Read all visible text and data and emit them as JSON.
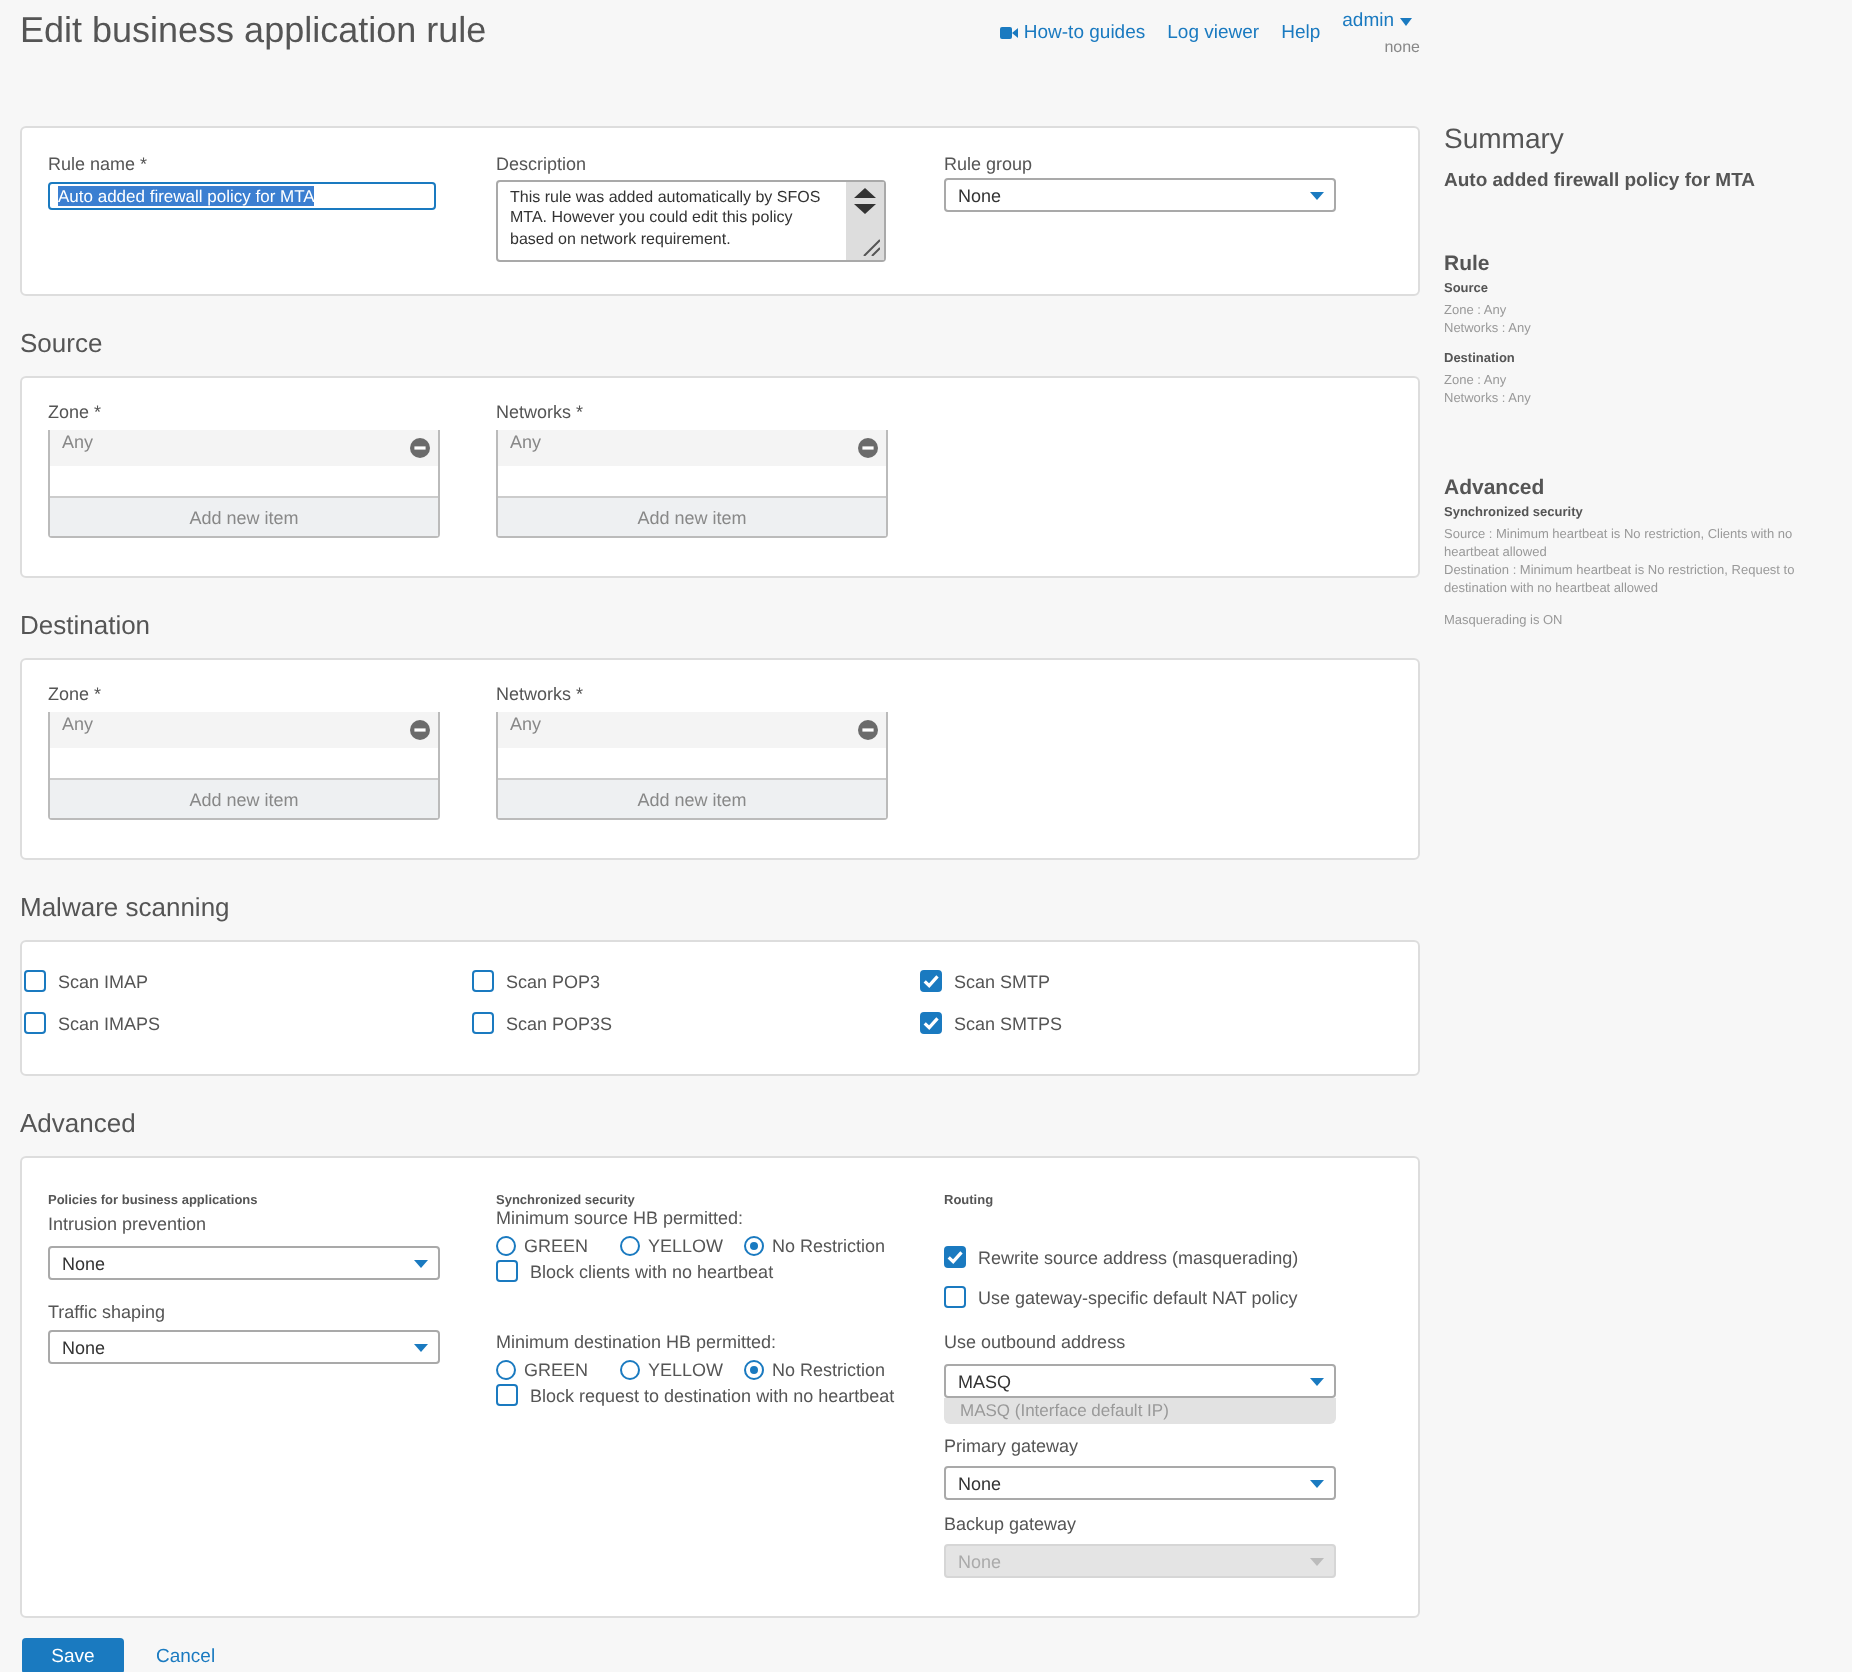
{
  "header": {
    "title": "Edit business application rule",
    "links": [
      {
        "label": "How-to guides",
        "kind": "video"
      },
      {
        "label": "Log viewer",
        "kind": "plain"
      },
      {
        "label": "Help",
        "kind": "plain"
      }
    ],
    "user": {
      "name": "admin",
      "subtitle": "none"
    }
  },
  "general": {
    "rule_name": {
      "label": "Rule name *",
      "value": "Auto added firewall policy for MTA",
      "text_selected": true
    },
    "description": {
      "label": "Description",
      "value": "This rule was added automatically by SFOS MTA. However you could edit this policy based on network requirement."
    },
    "rule_group": {
      "label": "Rule group",
      "value": "None",
      "disabled": false
    }
  },
  "source": {
    "title": "Source",
    "lists": [
      {
        "label": "Zone *",
        "items": [
          "Any"
        ],
        "add_label": "Add new item"
      },
      {
        "label": "Networks *",
        "items": [
          "Any"
        ],
        "add_label": "Add new item"
      }
    ]
  },
  "destination": {
    "title": "Destination",
    "lists": [
      {
        "label": "Zone *",
        "items": [
          "Any"
        ],
        "add_label": "Add new item"
      },
      {
        "label": "Networks *",
        "items": [
          "Any"
        ],
        "add_label": "Add new item"
      }
    ]
  },
  "malware_scanning": {
    "title": "Malware scanning",
    "options": [
      {
        "label": "Scan IMAP",
        "checked": false
      },
      {
        "label": "Scan POP3",
        "checked": false
      },
      {
        "label": "Scan SMTP",
        "checked": true
      },
      {
        "label": "Scan IMAPS",
        "checked": false
      },
      {
        "label": "Scan POP3S",
        "checked": false
      },
      {
        "label": "Scan SMTPS",
        "checked": true
      }
    ]
  },
  "advanced": {
    "title": "Advanced",
    "policies": {
      "heading": "Policies for business applications",
      "fields": [
        {
          "label": "Intrusion prevention",
          "value": "None",
          "disabled": false
        },
        {
          "label": "Traffic shaping",
          "value": "None",
          "disabled": false
        }
      ]
    },
    "sync": {
      "heading": "Synchronized security",
      "groups": [
        {
          "label": "Minimum source HB permitted:",
          "options": [
            {
              "label": "GREEN",
              "selected": false
            },
            {
              "label": "YELLOW",
              "selected": false
            },
            {
              "label": "No Restriction",
              "selected": true
            }
          ],
          "block": {
            "label": "Block clients with no heartbeat",
            "checked": false
          }
        },
        {
          "label": "Minimum destination HB permitted:",
          "options": [
            {
              "label": "GREEN",
              "selected": false
            },
            {
              "label": "YELLOW",
              "selected": false
            },
            {
              "label": "No Restriction",
              "selected": true
            }
          ],
          "block": {
            "label": "Block request to destination with no heartbeat",
            "checked": false
          }
        }
      ]
    },
    "routing": {
      "heading": "Routing",
      "checks": [
        {
          "label": "Rewrite source address (masquerading)",
          "checked": true
        },
        {
          "label": "Use gateway-specific default NAT policy",
          "checked": false
        }
      ],
      "outbound": {
        "label": "Use outbound address",
        "value": "MASQ",
        "disabled": false,
        "note": "MASQ (Interface default IP)"
      },
      "gateways": [
        {
          "label": "Primary gateway",
          "value": "None",
          "disabled": false
        },
        {
          "label": "Backup gateway",
          "value": "None",
          "disabled": true
        }
      ]
    }
  },
  "summary": {
    "title": "Summary",
    "name": "Auto added firewall policy for MTA",
    "sections": [
      {
        "title": "Rule",
        "groups": [
          {
            "heading": "Source",
            "lines": [
              "Zone : Any",
              "Networks : Any"
            ]
          },
          {
            "heading": "Destination",
            "lines": [
              "Zone : Any",
              "Networks : Any"
            ]
          }
        ]
      },
      {
        "title": "Advanced",
        "groups": [
          {
            "heading": "Synchronized security",
            "lines": [
              "Source : Minimum heartbeat is No restriction, Clients with no heartbeat allowed",
              "Destination : Minimum heartbeat is No restriction, Request to destination with no heartbeat allowed"
            ]
          }
        ],
        "notes": [
          "Masquerading is ON"
        ]
      }
    ]
  },
  "footer": {
    "buttons": [
      {
        "label": "Save",
        "kind": "primary"
      },
      {
        "label": "Cancel",
        "kind": "link"
      }
    ]
  }
}
